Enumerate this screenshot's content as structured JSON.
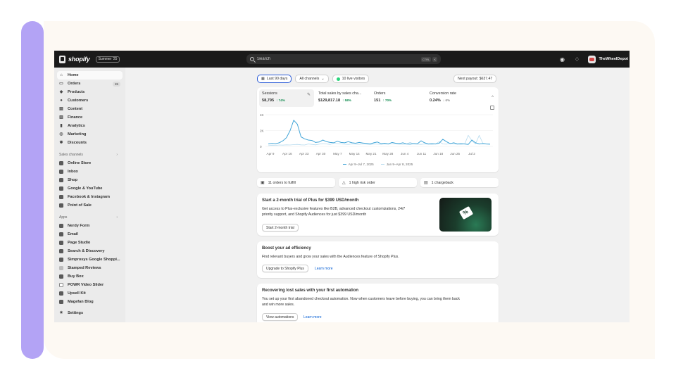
{
  "topbar": {
    "logo": "shopify",
    "edition_badge": "Summer '25",
    "search_placeholder": "Search",
    "shortcut_keys": [
      "CTRL",
      "K"
    ],
    "store_name": "TheWheelDepot"
  },
  "sidebar": {
    "main_items": [
      {
        "label": "Home",
        "icon": "home-icon",
        "active": true
      },
      {
        "label": "Orders",
        "icon": "orders-icon",
        "count": "15"
      },
      {
        "label": "Products",
        "icon": "tag-icon"
      },
      {
        "label": "Customers",
        "icon": "person-icon"
      },
      {
        "label": "Content",
        "icon": "content-icon"
      },
      {
        "label": "Finance",
        "icon": "bank-icon"
      },
      {
        "label": "Analytics",
        "icon": "bar-chart-icon"
      },
      {
        "label": "Marketing",
        "icon": "target-icon"
      },
      {
        "label": "Discounts",
        "icon": "discount-icon"
      }
    ],
    "sales_channels_label": "Sales channels",
    "sales_channels": [
      {
        "label": "Online Store"
      },
      {
        "label": "Inbox"
      },
      {
        "label": "Shop"
      },
      {
        "label": "Google & YouTube"
      },
      {
        "label": "Facebook & Instagram"
      },
      {
        "label": "Point of Sale"
      }
    ],
    "apps_label": "Apps",
    "apps": [
      {
        "label": "Nerdy Form"
      },
      {
        "label": "Email"
      },
      {
        "label": "Page Studio"
      },
      {
        "label": "Search & Discovery"
      },
      {
        "label": "Simprosys Google Shoppi..."
      },
      {
        "label": "Stamped Reviews"
      },
      {
        "label": "Buy Box"
      },
      {
        "label": "POWR Video Slider"
      },
      {
        "label": "Upsell Kit"
      },
      {
        "label": "Magefan Blog"
      }
    ],
    "settings_label": "Settings"
  },
  "filters": {
    "date_range": "Last 90 days",
    "channels": "All channels",
    "live_visitors": "10 live visitors",
    "payout": "Next payout: $637.47"
  },
  "metrics": [
    {
      "label": "Sessions",
      "value": "58,795",
      "delta": "↑ 74%",
      "positive": true
    },
    {
      "label": "Total sales by sales cha...",
      "value": "$129,817.18",
      "delta": "↑ 58%",
      "positive": true
    },
    {
      "label": "Orders",
      "value": "151",
      "delta": "↑ 70%",
      "positive": true
    },
    {
      "label": "Conversion rate",
      "value": "0.24%",
      "delta": "↓ 6%",
      "positive": false
    }
  ],
  "chart_data": {
    "type": "line",
    "y_tick_labels": [
      "4K",
      "2K",
      "0"
    ],
    "ylim": [
      0,
      4000
    ],
    "x_tick_labels": [
      "Apr 9",
      "Apr 16",
      "Apr 23",
      "Apr 30",
      "May 7",
      "May 14",
      "May 21",
      "May 28",
      "Jun 4",
      "Jun 11",
      "Jun 18",
      "Jun 25",
      "Jul 2"
    ],
    "grid": true,
    "legend_position": "bottom",
    "series": [
      {
        "name": "Apr 9–Jul 7, 2025",
        "color": "#44a6d8",
        "values": [
          300,
          380,
          320,
          450,
          700,
          1100,
          2000,
          3300,
          2800,
          1200,
          950,
          800,
          750,
          500,
          550,
          800,
          600,
          500,
          450,
          650,
          500,
          450,
          600,
          450,
          400,
          500,
          420,
          380,
          300,
          450,
          550,
          350,
          400,
          300,
          500,
          400,
          350,
          450,
          300,
          280,
          350,
          320,
          700,
          450,
          300,
          350,
          300,
          400,
          900,
          600,
          350,
          450,
          300,
          350,
          300,
          250,
          800,
          450,
          300,
          350,
          300,
          280
        ]
      },
      {
        "name": "Jan 9–Apr 8, 2025",
        "color": "#b8dcef",
        "values": [
          100,
          150,
          120,
          180,
          160,
          200,
          180,
          220,
          250,
          200,
          180,
          300,
          250,
          200,
          280,
          350,
          300,
          250,
          400,
          350,
          300,
          280,
          250,
          300,
          280,
          260,
          300,
          280,
          250,
          300,
          280,
          260,
          300,
          280,
          320,
          300,
          280,
          260,
          300,
          500,
          300,
          280,
          250,
          300,
          280,
          260,
          300,
          600,
          300,
          280,
          400,
          300,
          280,
          260,
          300,
          1400,
          700,
          300,
          1400,
          400,
          300,
          280
        ]
      }
    ]
  },
  "alerts": [
    {
      "label": "11 orders to fulfill",
      "icon": "fulfill-icon"
    },
    {
      "label": "1 high risk order",
      "icon": "warning-icon"
    },
    {
      "label": "1 chargeback",
      "icon": "chargeback-icon"
    }
  ],
  "promo": {
    "title": "Start a 2-month trial of Plus for $399 USD/month",
    "body_line1": "Get access to Plus-exclusive features like B2B, advanced checkout customizations, 24/7",
    "body_line2": "priority support, and Shopify Audiences for just $399 USD/month",
    "button": "Start 2-month trial"
  },
  "boost": {
    "title": "Boost your ad efficiency",
    "body": "Find relevant buyers and grow your sales with the Audiences feature of Shopify Plus.",
    "button": "Upgrade to Shopify Plus",
    "link": "Learn more"
  },
  "recover": {
    "title": "Recovering lost sales with your first automation",
    "body_line1": "You set up your first abandoned checkout automation. Now when customers leave before buying, you can bring them back",
    "body_line2": "and win more sales.",
    "button": "View automations",
    "link": "Learn more"
  }
}
